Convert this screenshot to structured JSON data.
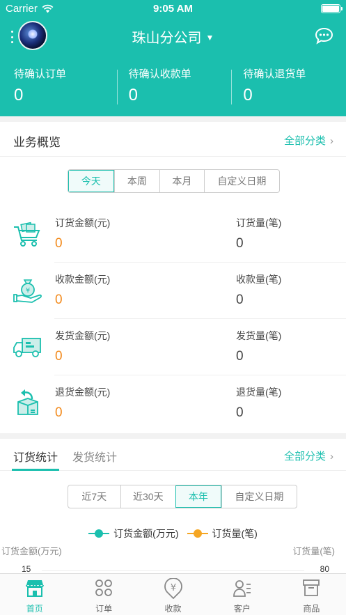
{
  "status_bar": {
    "carrier": "Carrier",
    "time": "9:05 AM"
  },
  "nav": {
    "title": "珠山分公司"
  },
  "pending": [
    {
      "label": "待确认订单",
      "value": "0"
    },
    {
      "label": "待确认收款单",
      "value": "0"
    },
    {
      "label": "待确认退货单",
      "value": "0"
    }
  ],
  "overview": {
    "title": "业务概览",
    "more_label": "全部分类",
    "periods": [
      "今天",
      "本周",
      "本月",
      "自定义日期"
    ],
    "active_period": "今天",
    "rows": [
      {
        "icon": "cart-icon",
        "amount_label": "订货金额(元)",
        "amount": "0",
        "count_label": "订货量(笔)",
        "count": "0"
      },
      {
        "icon": "money-bag-hand-icon",
        "amount_label": "收款金额(元)",
        "amount": "0",
        "count_label": "收款量(笔)",
        "count": "0"
      },
      {
        "icon": "delivery-truck-icon",
        "amount_label": "发货金额(元)",
        "amount": "0",
        "count_label": "发货量(笔)",
        "count": "0"
      },
      {
        "icon": "return-box-icon",
        "amount_label": "退货金额(元)",
        "amount": "0",
        "count_label": "退货量(笔)",
        "count": "0"
      }
    ]
  },
  "stats": {
    "tabs": [
      "订货统计",
      "发货统计"
    ],
    "active_tab": "订货统计",
    "more_label": "全部分类",
    "periods": [
      "近7天",
      "近30天",
      "本年",
      "自定义日期"
    ],
    "active_period": "本年",
    "legend": [
      {
        "name": "订货金额(万元)",
        "color": "#1bbfae"
      },
      {
        "name": "订货量(笔)",
        "color": "#f5a623"
      }
    ],
    "left_axis_label": "订货金额(万元)",
    "right_axis_label": "订货量(笔)",
    "left_top_tick": "15",
    "right_top_tick": "80"
  },
  "tabbar": [
    {
      "label": "首页",
      "icon": "store-icon",
      "active": true
    },
    {
      "label": "订单",
      "icon": "grid-icon",
      "active": false
    },
    {
      "label": "收款",
      "icon": "yuan-icon",
      "active": false
    },
    {
      "label": "客户",
      "icon": "contact-icon",
      "active": false
    },
    {
      "label": "商品",
      "icon": "box-icon",
      "active": false
    }
  ],
  "colors": {
    "brand": "#1bbfae",
    "orange": "#f28a1c"
  }
}
